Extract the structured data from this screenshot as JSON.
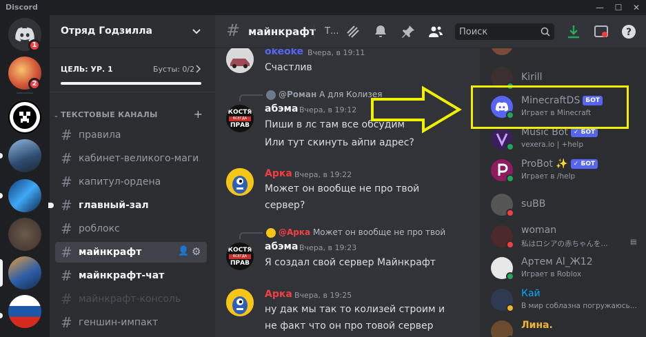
{
  "app": {
    "brand": "Discord"
  },
  "guilds": {
    "badge1": "1",
    "badge2": "2"
  },
  "server": {
    "name": "Отряд Годзилла",
    "goal": "ЦЕЛЬ: УР. 1",
    "boosts": "Бусты: 0/2"
  },
  "category": "ТЕКСТОВЫЕ КАНАЛЫ",
  "channels": [
    {
      "name": "правила"
    },
    {
      "name": "кабинет-великого-маги..."
    },
    {
      "name": "капитул-ордена"
    },
    {
      "name": "главный-зал"
    },
    {
      "name": "роблокс"
    },
    {
      "name": "майнкрафт"
    },
    {
      "name": "майнкрафт-чат"
    },
    {
      "name": "майнкрафт-консоль"
    },
    {
      "name": "геншин-импакт"
    }
  ],
  "topbar": {
    "channel": "майнкрафт",
    "topic": "Т...",
    "search_placeholder": "Поиск"
  },
  "messages": [
    {
      "author": "okeoke",
      "time": "Вчера, в 19:11",
      "lines": [
        "Счастлив"
      ],
      "color": "#5865f2"
    },
    {
      "reply_author": "@Роман",
      "reply_text": "А для Колизея",
      "author": "абэма",
      "time": "Вчера, в 19:12",
      "lines": [
        "Пиши в лс там все обсудим",
        "Или тут скинуть айпи адрес?"
      ],
      "color": "#f2f3f5"
    },
    {
      "author": "Арка",
      "time": "Вчера, в 19:22",
      "lines": [
        "Может он вообще не про твой",
        "сервер?"
      ],
      "color": "#f23f43"
    },
    {
      "reply_author": "@Арка",
      "reply_text": "Может он вообще не про твой",
      "author": "абэма",
      "time": "Вчера, в 19:23",
      "lines": [
        "Я создал свой сервер Майнкрафт"
      ],
      "color": "#f2f3f5"
    },
    {
      "author": "Арка",
      "time": "Вчера, в 19:25",
      "lines": [
        "ну дак мы так то колизей строим и",
        "не факт что он про товой сервер"
      ],
      "color": "#f23f43"
    }
  ],
  "avatar_text": {
    "kostya1": "КОСТЯ",
    "vsegda": "ВСЕГДА",
    "prav": "ПРАВ"
  },
  "members": [
    {
      "name": "Kirill",
      "sub": "",
      "status": "online",
      "color": "#949ba4"
    },
    {
      "name": "MinecraftDS",
      "badge": "БОТ",
      "sub": "Играет в Minecraft",
      "status": "online",
      "color": "#949ba4"
    },
    {
      "name": "Music Bot",
      "badge": "БОТ",
      "sub": "vexera.io | +help",
      "status": "online",
      "color": "#949ba4"
    },
    {
      "name": "ProBot",
      "sparkle": "✨",
      "badge": "БОТ",
      "sub": "Играет в /help",
      "status": "online",
      "color": "#949ba4"
    },
    {
      "name": "suBB",
      "sub": "",
      "status": "dnd",
      "color": "#949ba4"
    },
    {
      "name": "woman",
      "sub": "私はロシアの赤ちゃんを...",
      "status": "dnd",
      "color": "#949ba4"
    },
    {
      "name": "Артем Al_Ж12",
      "sub": "Играет в Roblox",
      "status": "online",
      "color": "#949ba4"
    },
    {
      "name": "Кай",
      "sub": "В мир соблазна погружаюсь...",
      "status": "idle",
      "color": "#00a8fc"
    },
    {
      "name": "Лина.",
      "sub": "",
      "status": "online",
      "color": "#f0b232"
    }
  ],
  "colors": {
    "accent": "#5865f2",
    "online": "#23a55a",
    "dnd": "#f23f43",
    "idle": "#f0b232",
    "highlight": "#f0f000"
  }
}
